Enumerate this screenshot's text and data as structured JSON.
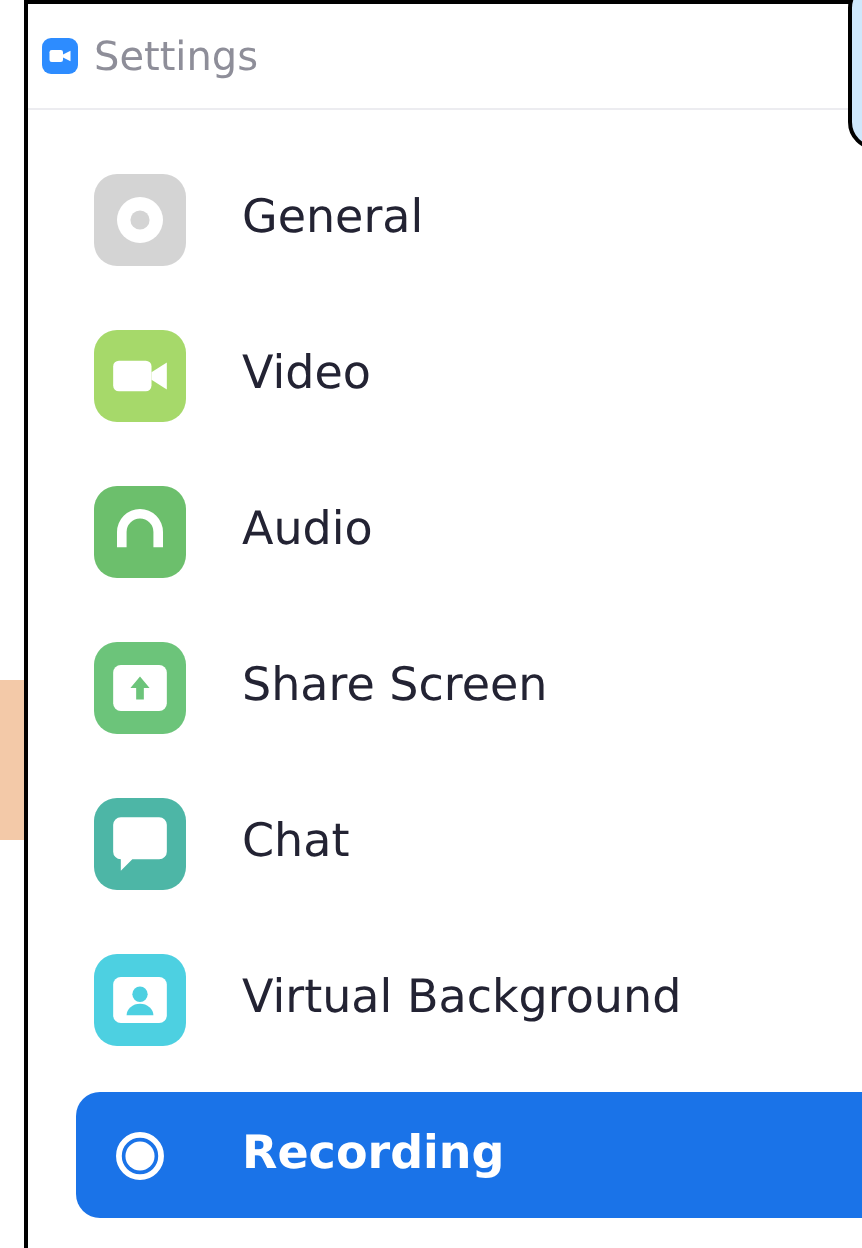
{
  "window": {
    "title": "Settings"
  },
  "sidebar": {
    "items": [
      {
        "label": "General",
        "kind": "general",
        "color": "#d4d4d4",
        "selected": false
      },
      {
        "label": "Video",
        "kind": "video",
        "color": "#a6d96a",
        "selected": false
      },
      {
        "label": "Audio",
        "kind": "audio",
        "color": "#6cbf6c",
        "selected": false
      },
      {
        "label": "Share Screen",
        "kind": "share",
        "color": "#6cc47a",
        "selected": false
      },
      {
        "label": "Chat",
        "kind": "chat",
        "color": "#4db6a6",
        "selected": false
      },
      {
        "label": "Virtual Background",
        "kind": "background",
        "color": "#4dd0e1",
        "selected": false
      },
      {
        "label": "Recording",
        "kind": "recording",
        "color": "#1a73e8",
        "selected": true
      }
    ]
  }
}
